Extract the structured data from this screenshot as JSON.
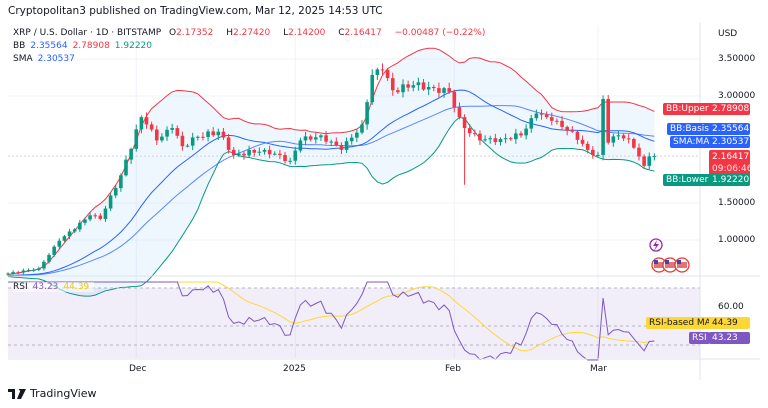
{
  "header": {
    "published": "Cryptopolitan3 published on TradingView.com, Mar 12, 2025 14:53 UTC"
  },
  "legend": {
    "symbol": "XRP / U.S. Dollar · 1D · BITSTAMP",
    "o_label": "O",
    "o": "2.17352",
    "h_label": "H",
    "h": "2.27420",
    "l_label": "L",
    "l": "2.14200",
    "c_label": "C",
    "c": "2.16417",
    "change": "−0.00487 (−0.22%)",
    "bb_label": "BB",
    "bb_basis": "2.35564",
    "bb_upper": "2.78908",
    "bb_lower": "1.92220",
    "sma_label": "SMA",
    "sma": "2.30537",
    "rsi_label": "RSI",
    "rsi": "43.23",
    "rsi_ma": "44.39"
  },
  "price_axis": {
    "currency": "USD",
    "ticks": [
      "3.50000",
      "3.00000",
      "1.50000",
      "1.00000"
    ]
  },
  "tags": {
    "bb_upper_label": "BB:Upper",
    "bb_upper": "2.78908",
    "bb_basis_label": "BB:Basis",
    "bb_basis": "2.35564",
    "sma_label": "SMA:MA",
    "sma": "2.30537",
    "last_price": "2.16417",
    "countdown": "09:06:46",
    "bb_lower_label": "BB:Lower",
    "bb_lower": "1.92220",
    "rsi_ma_label": "RSI-based MA",
    "rsi_ma": "44.39",
    "rsi_label": "RSI",
    "rsi": "43.23"
  },
  "rsi_axis": {
    "ticks": [
      "60.00"
    ]
  },
  "time_axis": {
    "labels": [
      "Dec",
      "2025",
      "Feb",
      "Mar"
    ]
  },
  "footer": {
    "brand": "TradingView"
  },
  "colors": {
    "up": "#089981",
    "down": "#f23645",
    "bb_upper": "#f23645",
    "bb_basis": "#2962ff",
    "bb_lower": "#089981",
    "sma": "#2962ff",
    "rsi": "#7e57c2",
    "rsi_ma": "#fdd835"
  },
  "chart_data": {
    "type": "candlestick",
    "title": "XRP / U.S. Dollar · 1D · BITSTAMP",
    "x_range": [
      "2024-11-06",
      "2025-03-12"
    ],
    "y_range": [
      0.5,
      3.7
    ],
    "close_keypoints": [
      [
        0,
        0.55
      ],
      [
        6,
        0.62
      ],
      [
        10,
        1.0
      ],
      [
        16,
        1.35
      ],
      [
        18,
        1.3
      ],
      [
        22,
        1.9
      ],
      [
        26,
        2.7
      ],
      [
        27,
        2.6
      ],
      [
        29,
        2.38
      ],
      [
        32,
        2.55
      ],
      [
        34,
        2.3
      ],
      [
        37,
        2.43
      ],
      [
        41,
        2.5
      ],
      [
        44,
        2.18
      ],
      [
        50,
        2.25
      ],
      [
        55,
        2.1
      ],
      [
        57,
        2.38
      ],
      [
        61,
        2.45
      ],
      [
        65,
        2.25
      ],
      [
        69,
        2.6
      ],
      [
        71,
        3.28
      ],
      [
        73,
        3.35
      ],
      [
        75,
        3.07
      ],
      [
        79,
        3.14
      ],
      [
        83,
        3.1
      ],
      [
        86,
        3.05
      ],
      [
        88,
        2.7
      ],
      [
        89,
        2.55
      ],
      [
        92,
        2.38
      ],
      [
        96,
        2.4
      ],
      [
        100,
        2.45
      ],
      [
        103,
        2.75
      ],
      [
        106,
        2.65
      ],
      [
        110,
        2.5
      ],
      [
        113,
        2.25
      ],
      [
        115,
        2.18
      ],
      [
        116,
        2.95
      ],
      [
        117,
        2.35
      ],
      [
        119,
        2.45
      ],
      [
        121,
        2.4
      ],
      [
        122,
        2.28
      ],
      [
        124,
        2.03
      ],
      [
        125,
        2.16
      ],
      [
        126,
        2.164
      ]
    ],
    "wicks": [
      [
        89,
        "low",
        1.77
      ],
      [
        116,
        "high",
        3.0
      ]
    ],
    "indicators": {
      "bb": {
        "length": 20,
        "mult": 2
      },
      "sma": {
        "length": 30
      },
      "rsi": {
        "length": 14,
        "ma_length": 14
      }
    },
    "time_labels": [
      [
        "Dec",
        25
      ],
      [
        "2025",
        56
      ],
      [
        "Feb",
        87
      ],
      [
        "Mar",
        115
      ]
    ]
  }
}
